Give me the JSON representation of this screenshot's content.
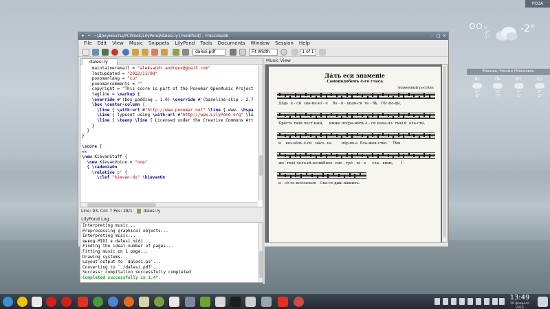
{
  "desktop": {
    "lang_indicator": "РОЗА",
    "weather": {
      "temperature": "-2°",
      "small_left": [
        "1°",
        "-2°"
      ],
      "small_right": [
        "-1°"
      ],
      "location": "Москва, Россия (Московск",
      "days": [
        {
          "label": "Вс",
          "hi": "-1°",
          "lo": "-6°"
        },
        {
          "label": "Пн",
          "hi": "-2°",
          "lo": "-7°"
        },
        {
          "label": "Вт",
          "hi": "-2°",
          "lo": "-1°"
        },
        {
          "label": "Ср",
          "hi": "0°",
          "lo": "-2°"
        }
      ]
    }
  },
  "window": {
    "title": "~/Документы/PCWeek/LilyPond/dalesi.ly [modified] – Frescobaldi",
    "menu": [
      "File",
      "Edit",
      "View",
      "Music",
      "Snippets",
      "LilyPond",
      "Tools",
      "Documents",
      "Window",
      "Session",
      "Help"
    ],
    "toolbar": {
      "document_select": "dalesi.pdf",
      "zoom_select": "Fit Width",
      "page_indicator": "1 of 1"
    }
  },
  "editor": {
    "tab_label": "dalesi.ly",
    "lines": [
      "    maintaineremail = \"aleksandr.andreev@gmail.com\"",
      "    lastupdated = \"2012/11/08\"",
      "    ponomarlang = \"cu\"",
      "    ponomarcomments = \"\"",
      "    copyright = \"This score is part of the Ponomar OpenMusic Project",
      "    tagline = \\markup {",
      "    \\override #'(box-padding . 1.0) \\override #'(baseline-skip . 2.7",
      "    \\box \\center-column {",
      "      \\line { \\with-url #\"http://www.ponomar.net\" \\line { www. \\hspa",
      "      \\line { Typeset using \\with-url #\"http://www.LilyPond.org\" \\li",
      "      \\line { \\teeny \\line { Licensed under the Creative Commons Att",
      "    }",
      "  }",
      "}",
      "",
      "\\score {",
      "<<",
      "\\new KievanStaff {",
      "  \\new KievanVoice = \"one\"",
      "  { \\cadenzaOn",
      "    \\relative c' {",
      "      \\clef \"kievan-do\" \\kievanOn"
    ],
    "status": "Line: 93, Col: 7  Pos: 28/1",
    "status_file": "dalesi.ly"
  },
  "log": {
    "title": "LilyPond Log",
    "lines": [
      "Interpreting music...",
      "Preprocessing graphical objects...",
      "Interpreting music...",
      "вывод MIDI в dalesi.midi...",
      "Finding the ideal number of pages...",
      "Fitting music on 1 page...",
      "Drawing systems...",
      "Layout output to `dalesi.ps'...",
      "Converting to `./dalesi.pdf'...",
      "Success: compilation successfully completed"
    ],
    "success_line": "Completed successfully in 1.4\"."
  },
  "music_view": {
    "title": "Music View",
    "score_title": "Да́лъ еси знаменіе",
    "score_subtitle": "Самоподобенъ 4-го гласа",
    "composer": "Знаменный роспѣвъ",
    "lyrics": [
      "Да́дь  е́ - сѝ  зна-ме-ні́ - е    бо - я́ - щым-ся  те - бѣ,  Гбс-по-ди,",
      "Крéсть твóй чест-ный,     и́мже посра-ми́ть е́ - сѝ нача-ла  тмы́ и́  вла-сти,",
      "и́    воз-вéль е́-сѝ   нáсъ  на        пéр-во-е  бла-жéн-ство.    Тѣ́м",
      "же  твоé чело-вѣ-колю́бное  смо - трé - ні - е     сла - вимъ,      І́ -",
      "и - сѐ-се всесильне   Спа-се дш́ь нáшихъ."
    ]
  },
  "taskbar": {
    "clock_time": "13:49",
    "clock_date": "20 февраля 2016"
  },
  "colors": {
    "keyword": "#0a0a8a",
    "string": "#b00000",
    "success": "#2e9a2e"
  }
}
